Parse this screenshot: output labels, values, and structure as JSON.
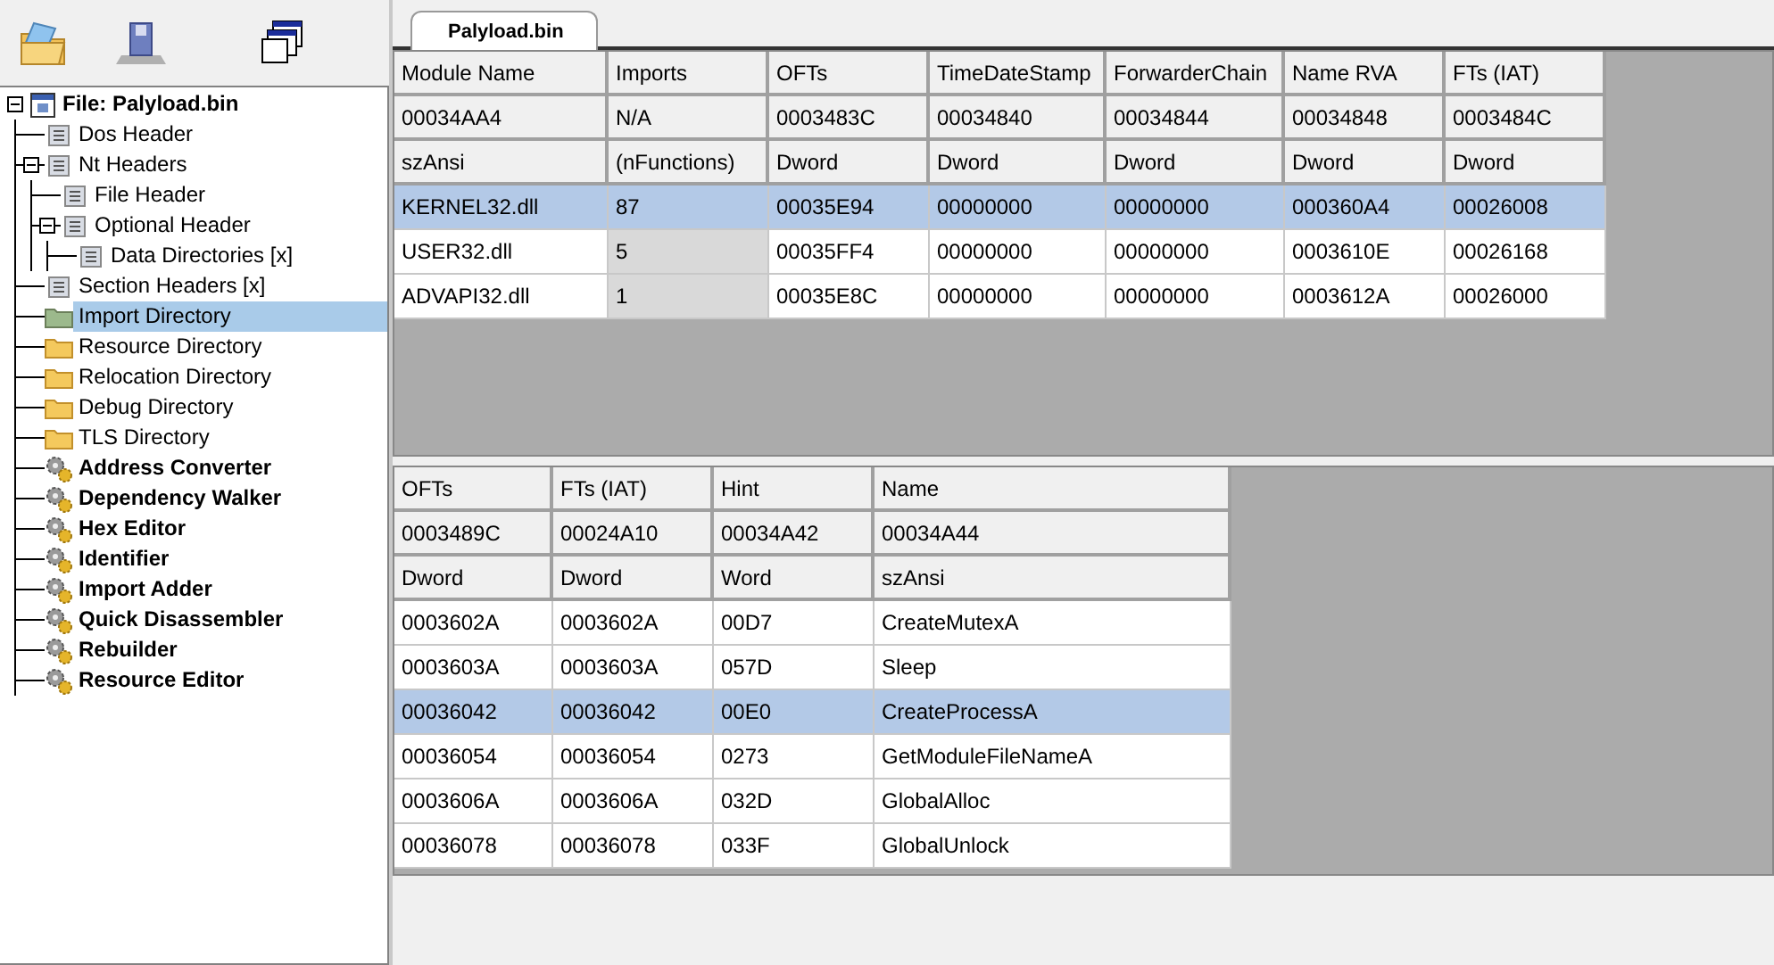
{
  "tree": {
    "label": "File: Palyload.bin",
    "kind": "file",
    "expanded": true,
    "selected": false,
    "children": [
      {
        "label": "Dos Header",
        "kind": "header",
        "selected": false
      },
      {
        "label": "Nt Headers",
        "kind": "header",
        "expanded": true,
        "selected": false,
        "children": [
          {
            "label": "File Header",
            "kind": "header",
            "selected": false
          },
          {
            "label": "Optional Header",
            "kind": "header",
            "expanded": true,
            "selected": false,
            "children": [
              {
                "label": "Data Directories [x]",
                "kind": "header",
                "selected": false
              }
            ]
          }
        ]
      },
      {
        "label": "Section Headers [x]",
        "kind": "header",
        "selected": false
      },
      {
        "label": "Import Directory",
        "kind": "folder",
        "selected": true
      },
      {
        "label": "Resource Directory",
        "kind": "folder",
        "selected": false
      },
      {
        "label": "Relocation Directory",
        "kind": "folder",
        "selected": false
      },
      {
        "label": "Debug Directory",
        "kind": "folder",
        "selected": false
      },
      {
        "label": "TLS Directory",
        "kind": "folder",
        "selected": false
      },
      {
        "label": "Address Converter",
        "kind": "tool",
        "selected": false
      },
      {
        "label": "Dependency Walker",
        "kind": "tool",
        "selected": false
      },
      {
        "label": "Hex Editor",
        "kind": "tool",
        "selected": false
      },
      {
        "label": "Identifier",
        "kind": "tool",
        "selected": false
      },
      {
        "label": "Import Adder",
        "kind": "tool",
        "selected": false
      },
      {
        "label": "Quick Disassembler",
        "kind": "tool",
        "selected": false
      },
      {
        "label": "Rebuilder",
        "kind": "tool",
        "selected": false
      },
      {
        "label": "Resource Editor",
        "kind": "tool",
        "selected": false
      }
    ]
  },
  "tabs": [
    {
      "label": "Palyload.bin",
      "selected": true
    }
  ],
  "modules_table": {
    "columns": [
      {
        "label": "Module Name",
        "readonly": false
      },
      {
        "label": "Imports",
        "readonly": true
      },
      {
        "label": "OFTs",
        "readonly": false
      },
      {
        "label": "TimeDateStamp",
        "readonly": false
      },
      {
        "label": "ForwarderChain",
        "readonly": false
      },
      {
        "label": "Name RVA",
        "readonly": false
      },
      {
        "label": "FTs (IAT)",
        "readonly": false
      }
    ],
    "info_rows": [
      [
        "00034AA4",
        "N/A",
        "0003483C",
        "00034840",
        "00034844",
        "00034848",
        "0003484C"
      ],
      [
        "szAnsi",
        "(nFunctions)",
        "Dword",
        "Dword",
        "Dword",
        "Dword",
        "Dword"
      ]
    ],
    "rows": [
      {
        "cells": [
          "KERNEL32.dll",
          "87",
          "00035E94",
          "00000000",
          "00000000",
          "000360A4",
          "00026008"
        ],
        "selected": true
      },
      {
        "cells": [
          "USER32.dll",
          "5",
          "00035FF4",
          "00000000",
          "00000000",
          "0003610E",
          "00026168"
        ],
        "selected": false
      },
      {
        "cells": [
          "ADVAPI32.dll",
          "1",
          "00035E8C",
          "00000000",
          "00000000",
          "0003612A",
          "00026000"
        ],
        "selected": false
      }
    ]
  },
  "functions_table": {
    "columns": [
      {
        "label": "OFTs"
      },
      {
        "label": "FTs (IAT)"
      },
      {
        "label": "Hint"
      },
      {
        "label": "Name"
      }
    ],
    "info_rows": [
      [
        "0003489C",
        "00024A10",
        "00034A42",
        "00034A44"
      ],
      [
        "Dword",
        "Dword",
        "Word",
        "szAnsi"
      ]
    ],
    "rows": [
      {
        "cells": [
          "0003602A",
          "0003602A",
          "00D7",
          "CreateMutexA"
        ],
        "selected": false
      },
      {
        "cells": [
          "0003603A",
          "0003603A",
          "057D",
          "Sleep"
        ],
        "selected": false
      },
      {
        "cells": [
          "00036042",
          "00036042",
          "00E0",
          "CreateProcessA"
        ],
        "selected": true
      },
      {
        "cells": [
          "00036054",
          "00036054",
          "0273",
          "GetModuleFileNameA"
        ],
        "selected": false
      },
      {
        "cells": [
          "0003606A",
          "0003606A",
          "032D",
          "GlobalAlloc"
        ],
        "selected": false
      },
      {
        "cells": [
          "00036078",
          "00036078",
          "033F",
          "GlobalUnlock"
        ],
        "selected": false
      }
    ]
  }
}
